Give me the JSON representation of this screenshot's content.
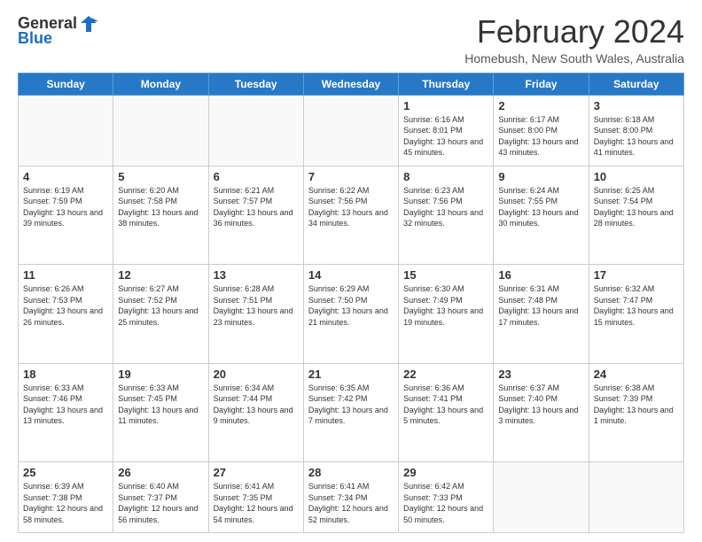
{
  "logo": {
    "line1": "General",
    "line2": "Blue"
  },
  "title": "February 2024",
  "subtitle": "Homebush, New South Wales, Australia",
  "days_of_week": [
    "Sunday",
    "Monday",
    "Tuesday",
    "Wednesday",
    "Thursday",
    "Friday",
    "Saturday"
  ],
  "weeks": [
    [
      {
        "day": "",
        "info": ""
      },
      {
        "day": "",
        "info": ""
      },
      {
        "day": "",
        "info": ""
      },
      {
        "day": "",
        "info": ""
      },
      {
        "day": "1",
        "info": "Sunrise: 6:16 AM\nSunset: 8:01 PM\nDaylight: 13 hours and 45 minutes."
      },
      {
        "day": "2",
        "info": "Sunrise: 6:17 AM\nSunset: 8:00 PM\nDaylight: 13 hours and 43 minutes."
      },
      {
        "day": "3",
        "info": "Sunrise: 6:18 AM\nSunset: 8:00 PM\nDaylight: 13 hours and 41 minutes."
      }
    ],
    [
      {
        "day": "4",
        "info": "Sunrise: 6:19 AM\nSunset: 7:59 PM\nDaylight: 13 hours and 39 minutes."
      },
      {
        "day": "5",
        "info": "Sunrise: 6:20 AM\nSunset: 7:58 PM\nDaylight: 13 hours and 38 minutes."
      },
      {
        "day": "6",
        "info": "Sunrise: 6:21 AM\nSunset: 7:57 PM\nDaylight: 13 hours and 36 minutes."
      },
      {
        "day": "7",
        "info": "Sunrise: 6:22 AM\nSunset: 7:56 PM\nDaylight: 13 hours and 34 minutes."
      },
      {
        "day": "8",
        "info": "Sunrise: 6:23 AM\nSunset: 7:56 PM\nDaylight: 13 hours and 32 minutes."
      },
      {
        "day": "9",
        "info": "Sunrise: 6:24 AM\nSunset: 7:55 PM\nDaylight: 13 hours and 30 minutes."
      },
      {
        "day": "10",
        "info": "Sunrise: 6:25 AM\nSunset: 7:54 PM\nDaylight: 13 hours and 28 minutes."
      }
    ],
    [
      {
        "day": "11",
        "info": "Sunrise: 6:26 AM\nSunset: 7:53 PM\nDaylight: 13 hours and 26 minutes."
      },
      {
        "day": "12",
        "info": "Sunrise: 6:27 AM\nSunset: 7:52 PM\nDaylight: 13 hours and 25 minutes."
      },
      {
        "day": "13",
        "info": "Sunrise: 6:28 AM\nSunset: 7:51 PM\nDaylight: 13 hours and 23 minutes."
      },
      {
        "day": "14",
        "info": "Sunrise: 6:29 AM\nSunset: 7:50 PM\nDaylight: 13 hours and 21 minutes."
      },
      {
        "day": "15",
        "info": "Sunrise: 6:30 AM\nSunset: 7:49 PM\nDaylight: 13 hours and 19 minutes."
      },
      {
        "day": "16",
        "info": "Sunrise: 6:31 AM\nSunset: 7:48 PM\nDaylight: 13 hours and 17 minutes."
      },
      {
        "day": "17",
        "info": "Sunrise: 6:32 AM\nSunset: 7:47 PM\nDaylight: 13 hours and 15 minutes."
      }
    ],
    [
      {
        "day": "18",
        "info": "Sunrise: 6:33 AM\nSunset: 7:46 PM\nDaylight: 13 hours and 13 minutes."
      },
      {
        "day": "19",
        "info": "Sunrise: 6:33 AM\nSunset: 7:45 PM\nDaylight: 13 hours and 11 minutes."
      },
      {
        "day": "20",
        "info": "Sunrise: 6:34 AM\nSunset: 7:44 PM\nDaylight: 13 hours and 9 minutes."
      },
      {
        "day": "21",
        "info": "Sunrise: 6:35 AM\nSunset: 7:42 PM\nDaylight: 13 hours and 7 minutes."
      },
      {
        "day": "22",
        "info": "Sunrise: 6:36 AM\nSunset: 7:41 PM\nDaylight: 13 hours and 5 minutes."
      },
      {
        "day": "23",
        "info": "Sunrise: 6:37 AM\nSunset: 7:40 PM\nDaylight: 13 hours and 3 minutes."
      },
      {
        "day": "24",
        "info": "Sunrise: 6:38 AM\nSunset: 7:39 PM\nDaylight: 13 hours and 1 minute."
      }
    ],
    [
      {
        "day": "25",
        "info": "Sunrise: 6:39 AM\nSunset: 7:38 PM\nDaylight: 12 hours and 58 minutes."
      },
      {
        "day": "26",
        "info": "Sunrise: 6:40 AM\nSunset: 7:37 PM\nDaylight: 12 hours and 56 minutes."
      },
      {
        "day": "27",
        "info": "Sunrise: 6:41 AM\nSunset: 7:35 PM\nDaylight: 12 hours and 54 minutes."
      },
      {
        "day": "28",
        "info": "Sunrise: 6:41 AM\nSunset: 7:34 PM\nDaylight: 12 hours and 52 minutes."
      },
      {
        "day": "29",
        "info": "Sunrise: 6:42 AM\nSunset: 7:33 PM\nDaylight: 12 hours and 50 minutes."
      },
      {
        "day": "",
        "info": ""
      },
      {
        "day": "",
        "info": ""
      }
    ]
  ]
}
